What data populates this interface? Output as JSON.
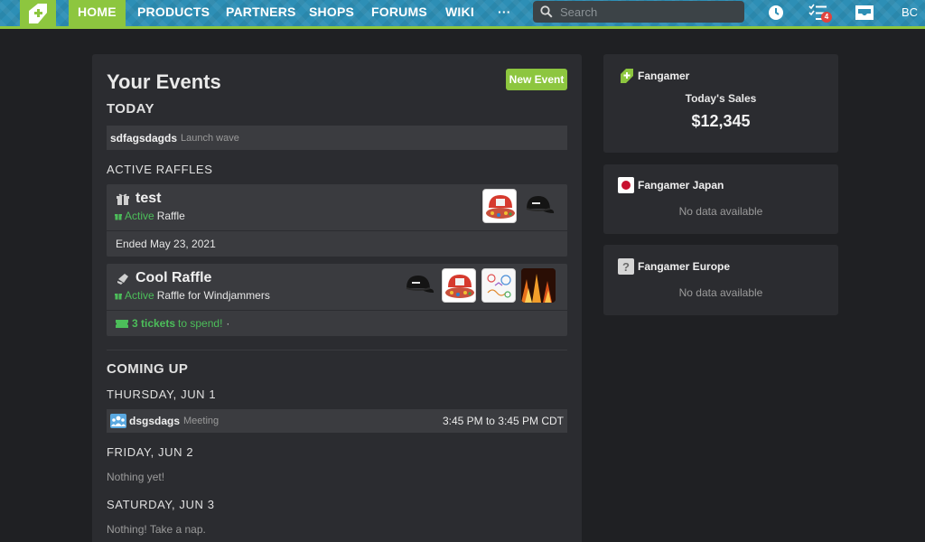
{
  "nav": {
    "items": [
      "HOME",
      "PRODUCTS",
      "PARTNERS",
      "SHOPS",
      "FORUMS",
      "WIKI",
      "···"
    ],
    "active": "HOME",
    "search_placeholder": "Search",
    "tasks_badge": "4",
    "user_initials": "BC",
    "accent_color": "#8dc63f",
    "bar_color": "#2d8fb6"
  },
  "events": {
    "title": "Your Events",
    "new_event_label": "New Event",
    "today_heading": "TODAY",
    "today_item": {
      "name": "sdfagsdagds",
      "kind": "Launch wave"
    },
    "raffles_heading": "ACTIVE RAFFLES",
    "raffles": [
      {
        "title": "test",
        "status": "Active",
        "detail": "Raffle",
        "footer": "Ended May 23, 2021",
        "icon": "gift-icon"
      },
      {
        "title": "Cool Raffle",
        "status": "Active",
        "detail": "Raffle for Windjammers",
        "tickets": "3 tickets",
        "tickets_suffix": "to spend!",
        "tickets_sep": "·",
        "icon": "disc-icon"
      }
    ],
    "coming_heading": "COMING UP",
    "days": [
      {
        "label": "THURSDAY, JUN 1"
      },
      {
        "label": "FRIDAY, JUN 2",
        "empty": "Nothing yet!"
      },
      {
        "label": "SATURDAY, JUN 3",
        "empty": "Nothing! Take a nap."
      }
    ],
    "meeting": {
      "name": "dsgsdags",
      "kind": "Meeting",
      "time": "3:45 PM to 3:45 PM CDT"
    }
  },
  "stores": [
    {
      "name": "Fangamer",
      "sales_label": "Today's Sales",
      "sales_value": "$12,345"
    },
    {
      "name": "Fangamer Japan",
      "empty": "No data available"
    },
    {
      "name": "Fangamer Europe",
      "empty": "No data available"
    }
  ]
}
